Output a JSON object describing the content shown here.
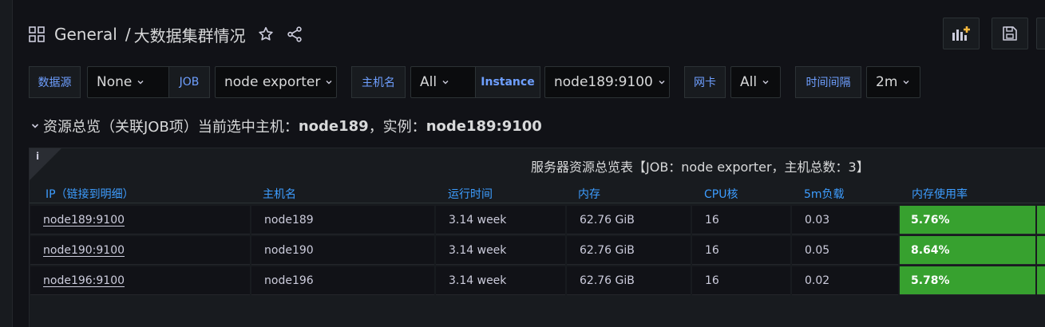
{
  "header": {
    "folder": "General",
    "separator": "/",
    "dashboard_title": "大数据集群情况"
  },
  "variables": [
    {
      "label": "数据源",
      "value": "None"
    },
    {
      "label": "JOB",
      "value": "node exporter"
    },
    {
      "label": "主机名",
      "value": "All"
    },
    {
      "label": "Instance",
      "value": "node189:9100"
    },
    {
      "label": "网卡",
      "value": "All"
    },
    {
      "label": "时间间隔",
      "value": "2m"
    }
  ],
  "row": {
    "prefix": "资源总览（关联JOB项）当前选中主机：",
    "host": "node189",
    "mid": "，实例：",
    "instance": "node189:9100"
  },
  "panel": {
    "info": "i",
    "title": "服务器资源总览表【JOB：node exporter，主机总数：3】",
    "columns": [
      "IP（链接到明细）",
      "主机名",
      "运行时间",
      "内存",
      "CPU核",
      "5m负载",
      "内存使用率"
    ],
    "rows": [
      [
        "node189:9100",
        "node189",
        "3.14 week",
        "62.76 GiB",
        "16",
        "0.03",
        "5.76%"
      ],
      [
        "node190:9100",
        "node190",
        "3.14 week",
        "62.76 GiB",
        "16",
        "0.05",
        "8.64%"
      ],
      [
        "node196:9100",
        "node196",
        "3.14 week",
        "62.76 GiB",
        "16",
        "0.02",
        "5.78%"
      ]
    ],
    "gauge_color": "#37a12f"
  },
  "colors": {
    "background": "#111217",
    "panel": "#181b1f",
    "accent_blue": "#6e9fff",
    "header_blue": "#3d9dff"
  }
}
